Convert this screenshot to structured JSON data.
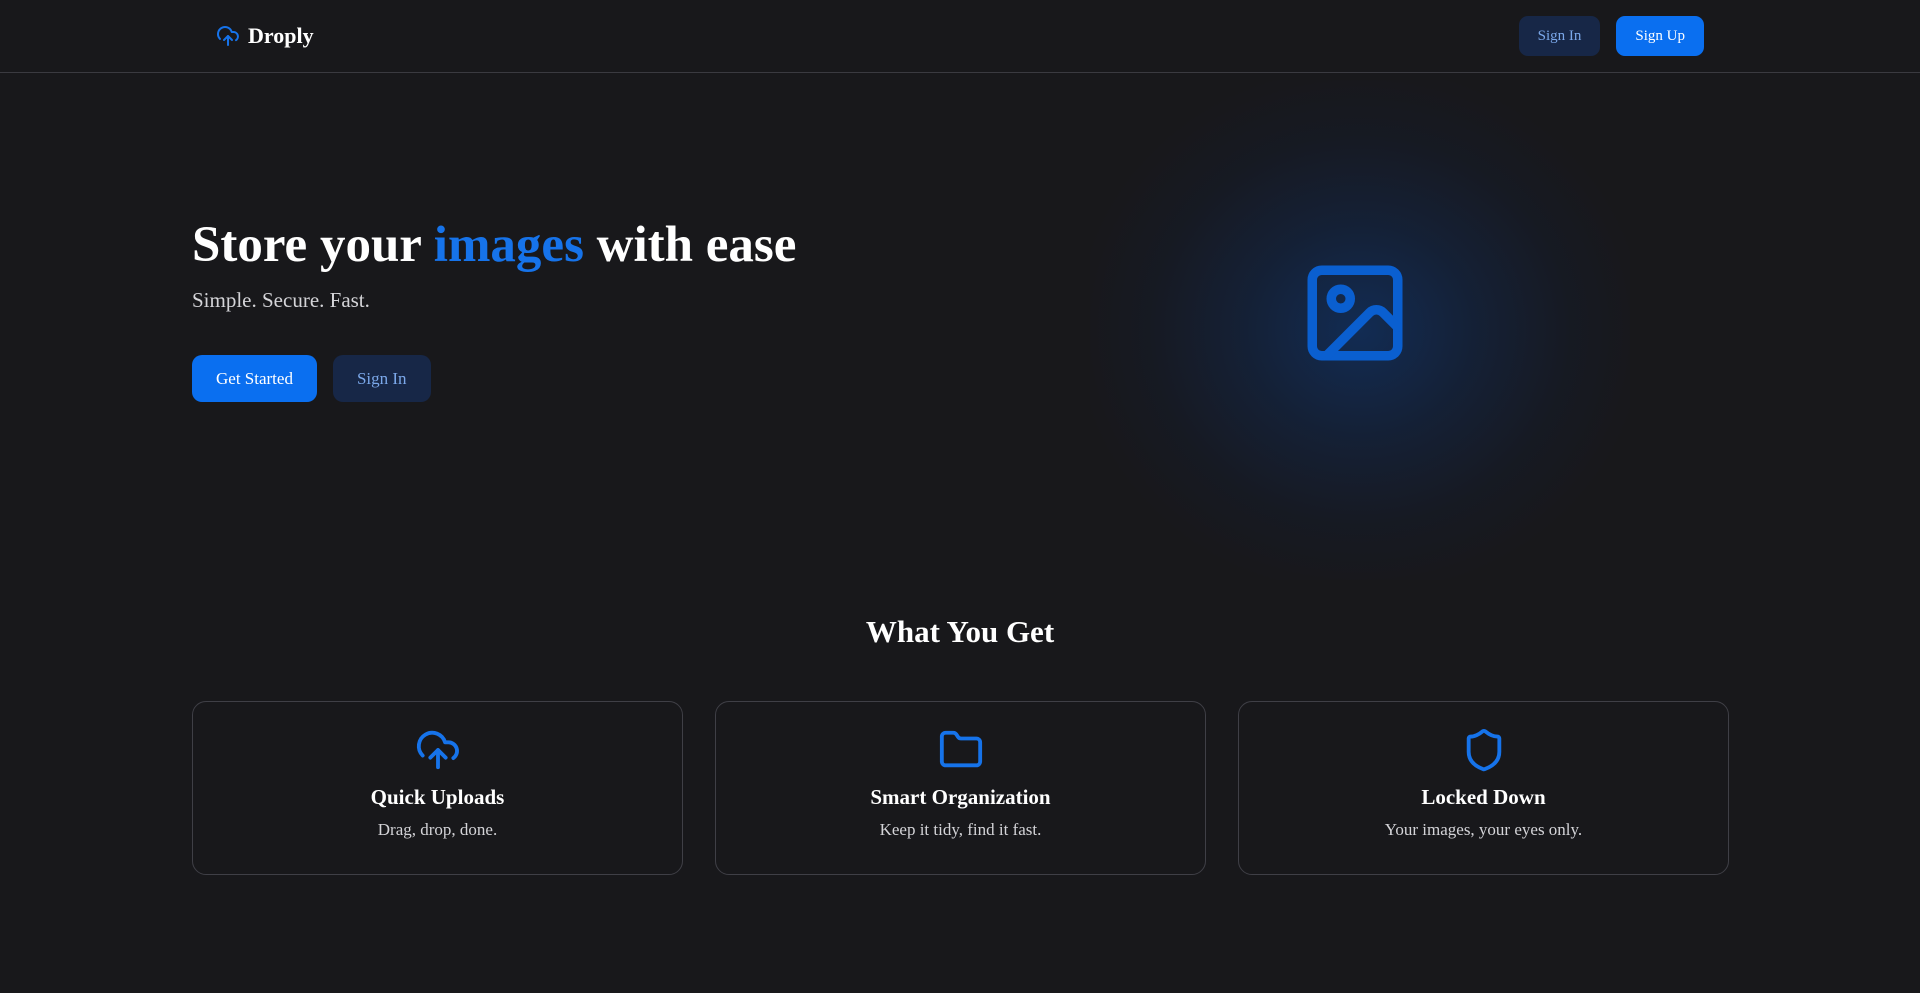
{
  "nav": {
    "brand": "Droply",
    "brand_icon": "cloud-upload-icon",
    "sign_in_label": "Sign In",
    "sign_up_label": "Sign Up"
  },
  "hero": {
    "title_before": "Store your ",
    "title_accent": "images",
    "title_after": " with ease",
    "subtitle": "Simple. Secure. Fast.",
    "get_started_label": "Get Started",
    "sign_in_label": "Sign In",
    "illustration_icon": "image-icon"
  },
  "features": {
    "heading": "What You Get",
    "items": [
      {
        "icon": "cloud-upload-icon",
        "title": "Quick Uploads",
        "description": "Drag, drop, done."
      },
      {
        "icon": "folder-icon",
        "title": "Smart Organization",
        "description": "Keep it tidy, find it fast."
      },
      {
        "icon": "shield-icon",
        "title": "Locked Down",
        "description": "Your images, your eyes only."
      }
    ]
  },
  "colors": {
    "background": "#18181b",
    "accent": "#0a6ff0",
    "accent_text": "#1673ea",
    "dark_button": "#172747",
    "dark_button_text": "#7ba8ea"
  }
}
